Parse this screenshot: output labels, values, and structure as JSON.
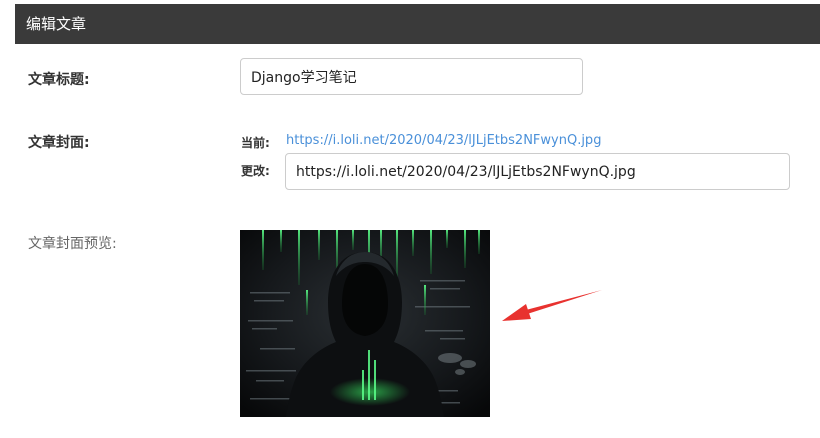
{
  "header": {
    "title": "编辑文章"
  },
  "form": {
    "title_label": "文章标题:",
    "title_value": "Django学习笔记",
    "cover_label": "文章封面:",
    "current_label": "当前:",
    "current_url": "https://i.loli.net/2020/04/23/lJLjEtbs2NFwynQ.jpg",
    "change_label": "更改:",
    "change_value": "https://i.loli.net/2020/04/23/lJLjEtbs2NFwynQ.jpg",
    "preview_label": "文章封面预览:"
  },
  "colors": {
    "header_bg": "#3a3a3a",
    "link": "#4a90d9",
    "annotation_arrow": "#e8322f"
  }
}
